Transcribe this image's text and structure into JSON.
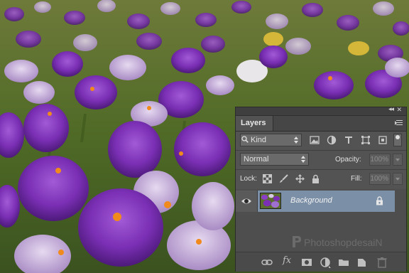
{
  "panel": {
    "tab_label": "Layers",
    "filter": {
      "kind_label": "Kind"
    },
    "blend": {
      "mode": "Normal",
      "opacity_label": "Opacity:",
      "opacity_value": "100%"
    },
    "lock": {
      "lock_label": "Lock:",
      "fill_label": "Fill:",
      "fill_value": "100%"
    },
    "layers": [
      {
        "name": "Background",
        "visible": true,
        "locked": true,
        "selected": true
      }
    ],
    "watermark": "PhotoshopdesaiN"
  },
  "colors": {
    "panel_bg": "#535353",
    "selection": "#7b8fa7",
    "photo_purple": "#7a2fb4",
    "grass": "#5f7a2c"
  },
  "icons": {
    "topbar": [
      "collapse-icon",
      "close-icon"
    ],
    "panel_menu": "panel-menu-icon",
    "filters": [
      "image-filter-icon",
      "adjustment-filter-icon",
      "type-filter-icon",
      "shape-filter-icon",
      "smart-object-filter-icon",
      "filter-toggle-icon"
    ],
    "locks": [
      "lock-transparent-pixels-icon",
      "lock-image-pixels-icon",
      "lock-position-icon",
      "lock-all-icon"
    ],
    "bottom": [
      "link-layers-icon",
      "fx-icon",
      "layer-mask-icon",
      "adjustment-layer-icon",
      "group-folder-icon",
      "new-layer-icon",
      "trash-icon"
    ]
  }
}
